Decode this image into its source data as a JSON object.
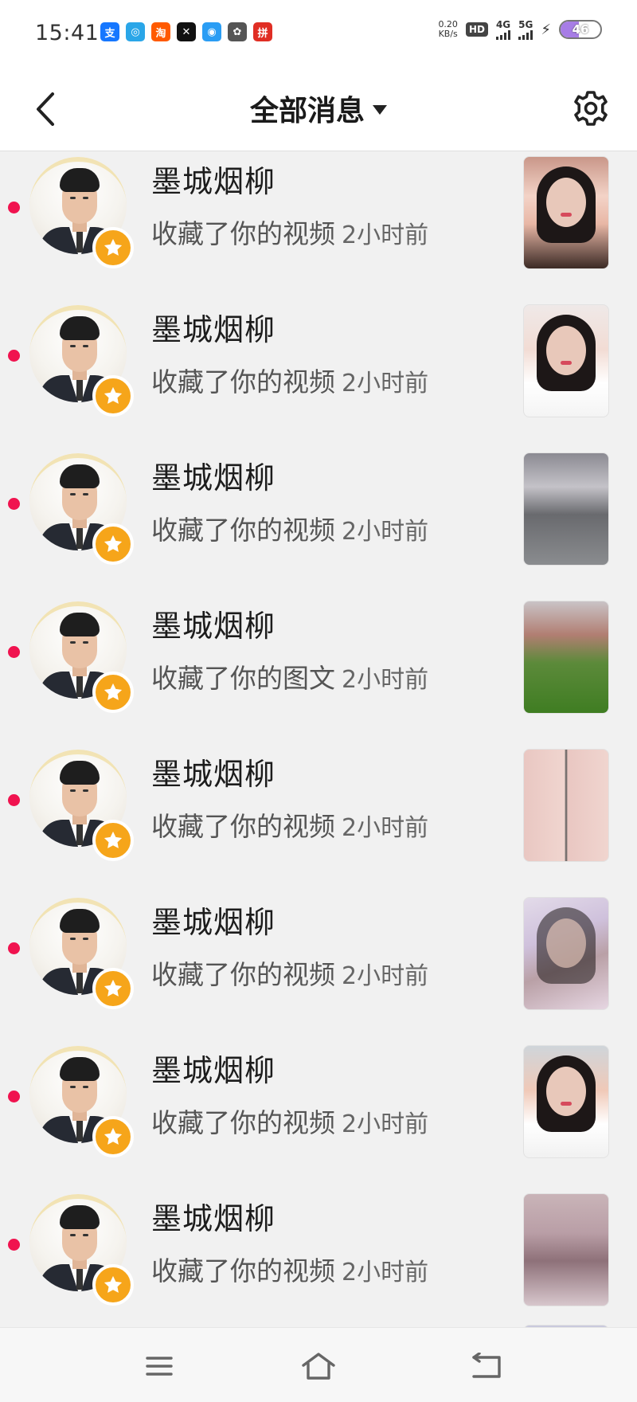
{
  "status_bar": {
    "time": "15:41",
    "net_speed_value": "0.20",
    "net_speed_unit": "KB/s",
    "hd_label": "HD",
    "sim1_label": "4G",
    "sim2_label": "5G",
    "battery_level": "46",
    "notification_icons": [
      "alipay-icon",
      "browser-icon",
      "taobao-icon",
      "capcut-icon",
      "qq-browser-icon",
      "fan-app-icon",
      "pinduoduo-icon"
    ],
    "notification_glyphs": [
      "支",
      "◎",
      "淘",
      "✕",
      "◉",
      "✿",
      "拼"
    ]
  },
  "header": {
    "title": "全部消息"
  },
  "colors": {
    "unread_dot": "#f0134f",
    "star_badge": "#f6a51a",
    "background": "#f1f1f1"
  },
  "messages": [
    {
      "name": "墨城烟柳",
      "action": "收藏了你的视频",
      "time_ago": "2小时前",
      "unread": true
    },
    {
      "name": "墨城烟柳",
      "action": "收藏了你的视频",
      "time_ago": "2小时前",
      "unread": true
    },
    {
      "name": "墨城烟柳",
      "action": "收藏了你的视频",
      "time_ago": "2小时前",
      "unread": true
    },
    {
      "name": "墨城烟柳",
      "action": "收藏了你的图文",
      "time_ago": "2小时前",
      "unread": true
    },
    {
      "name": "墨城烟柳",
      "action": "收藏了你的视频",
      "time_ago": "2小时前",
      "unread": true
    },
    {
      "name": "墨城烟柳",
      "action": "收藏了你的视频",
      "time_ago": "2小时前",
      "unread": true
    },
    {
      "name": "墨城烟柳",
      "action": "收藏了你的视频",
      "time_ago": "2小时前",
      "unread": true
    },
    {
      "name": "墨城烟柳",
      "action": "收藏了你的视频",
      "time_ago": "2小时前",
      "unread": true
    }
  ],
  "nav_bar": {
    "items": [
      "menu-icon",
      "home-icon",
      "back-icon"
    ]
  }
}
